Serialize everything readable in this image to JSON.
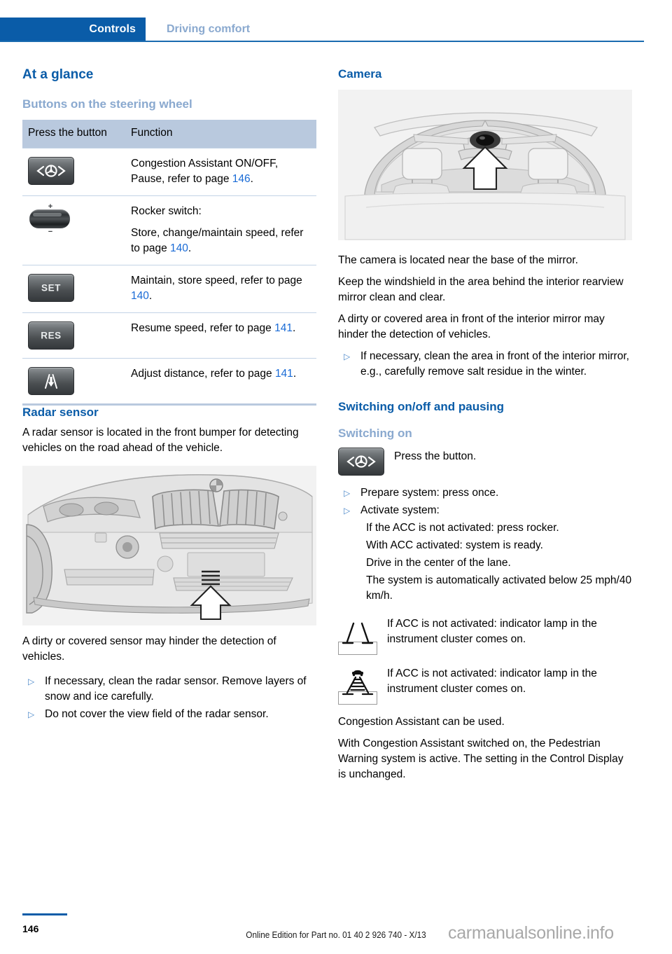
{
  "header": {
    "tab_active": "Controls",
    "tab_section": "Driving comfort",
    "accent_blue": "#0a5ca8",
    "muted_blue": "#8aa9cf"
  },
  "left_column": {
    "h_at_a_glance": "At a glance",
    "h_buttons": "Buttons on the steering wheel",
    "table": {
      "headers": [
        "Press the button",
        "Function"
      ],
      "rows": [
        {
          "icon": "steering-wheel-button-icon",
          "lines": [
            "Congestion Assistant ON/OFF, Pause, refer to page 146."
          ],
          "pageref": "146"
        },
        {
          "icon": "rocker-switch-icon",
          "lines": [
            "Rocker switch:",
            "Store, change/maintain speed, refer to page 140."
          ],
          "pageref": "140"
        },
        {
          "icon": "set-button-icon",
          "label": "SET",
          "lines": [
            "Maintain, store speed, refer to page 140."
          ],
          "pageref": "140"
        },
        {
          "icon": "res-button-icon",
          "label": "RES",
          "lines": [
            "Resume speed, refer to page 141."
          ],
          "pageref": "141"
        },
        {
          "icon": "adjust-distance-button-icon",
          "lines": [
            "Adjust distance, refer to page 141."
          ],
          "pageref": "141"
        }
      ]
    },
    "h_radar": "Radar sensor",
    "radar_paragraph": "A radar sensor is located in the front bumper for detecting vehicles on the road ahead of the vehicle.",
    "radar_figure_alt": "Front bumper of vehicle with arrow pointing to radar sensor location",
    "radar_note": "A dirty or covered sensor may hinder the detection of vehicles.",
    "radar_bullets": [
      "If necessary, clean the radar sensor. Remove layers of snow and ice carefully.",
      "Do not cover the view field of the radar sensor."
    ]
  },
  "right_column": {
    "h_camera": "Camera",
    "camera_figure_alt": "View through windshield from inside with arrow pointing to camera near the rearview mirror",
    "camera_paragraphs": [
      "The camera is located near the base of the mirror.",
      "Keep the windshield in the area behind the interior rearview mirror clean and clear.",
      "A dirty or covered area in front of the interior mirror may hinder the detection of vehicles."
    ],
    "camera_bullets": [
      "If necessary, clean the area in front of the interior mirror, e.g., carefully remove salt residue in the winter."
    ],
    "h_switching": "Switching on/off and pausing",
    "h_switching_on": "Switching on",
    "press_button_text": "Press the button.",
    "press_button_icon": "steering-wheel-button-icon",
    "switching_bullets": [
      "Prepare system: press once.",
      "Activate system:"
    ],
    "switching_sublines": [
      "If the ACC is not activated: press rocker.",
      "With ACC activated: system is ready.",
      "Drive in the center of the lane.",
      "The system is automatically activated below 25 mph/40 km/h."
    ],
    "lamps": [
      {
        "icon": "lane-markings-indicator-icon",
        "text": "If ACC is not activated: indicator lamp in the instrument cluster comes on."
      },
      {
        "icon": "vehicle-in-lane-indicator-icon",
        "text": "If ACC is not activated: indicator lamp in the instrument cluster comes on."
      }
    ],
    "closing_paragraphs": [
      "Congestion Assistant can be used.",
      "With Congestion Assistant switched on, the Pedestrian Warning system is active. The setting in the Control Display is unchanged."
    ]
  },
  "footer": {
    "page_number": "146",
    "edition_line": "Online Edition for Part no. 01 40 2 926 740 - X/13",
    "watermark": "carmanualsonline.info"
  }
}
